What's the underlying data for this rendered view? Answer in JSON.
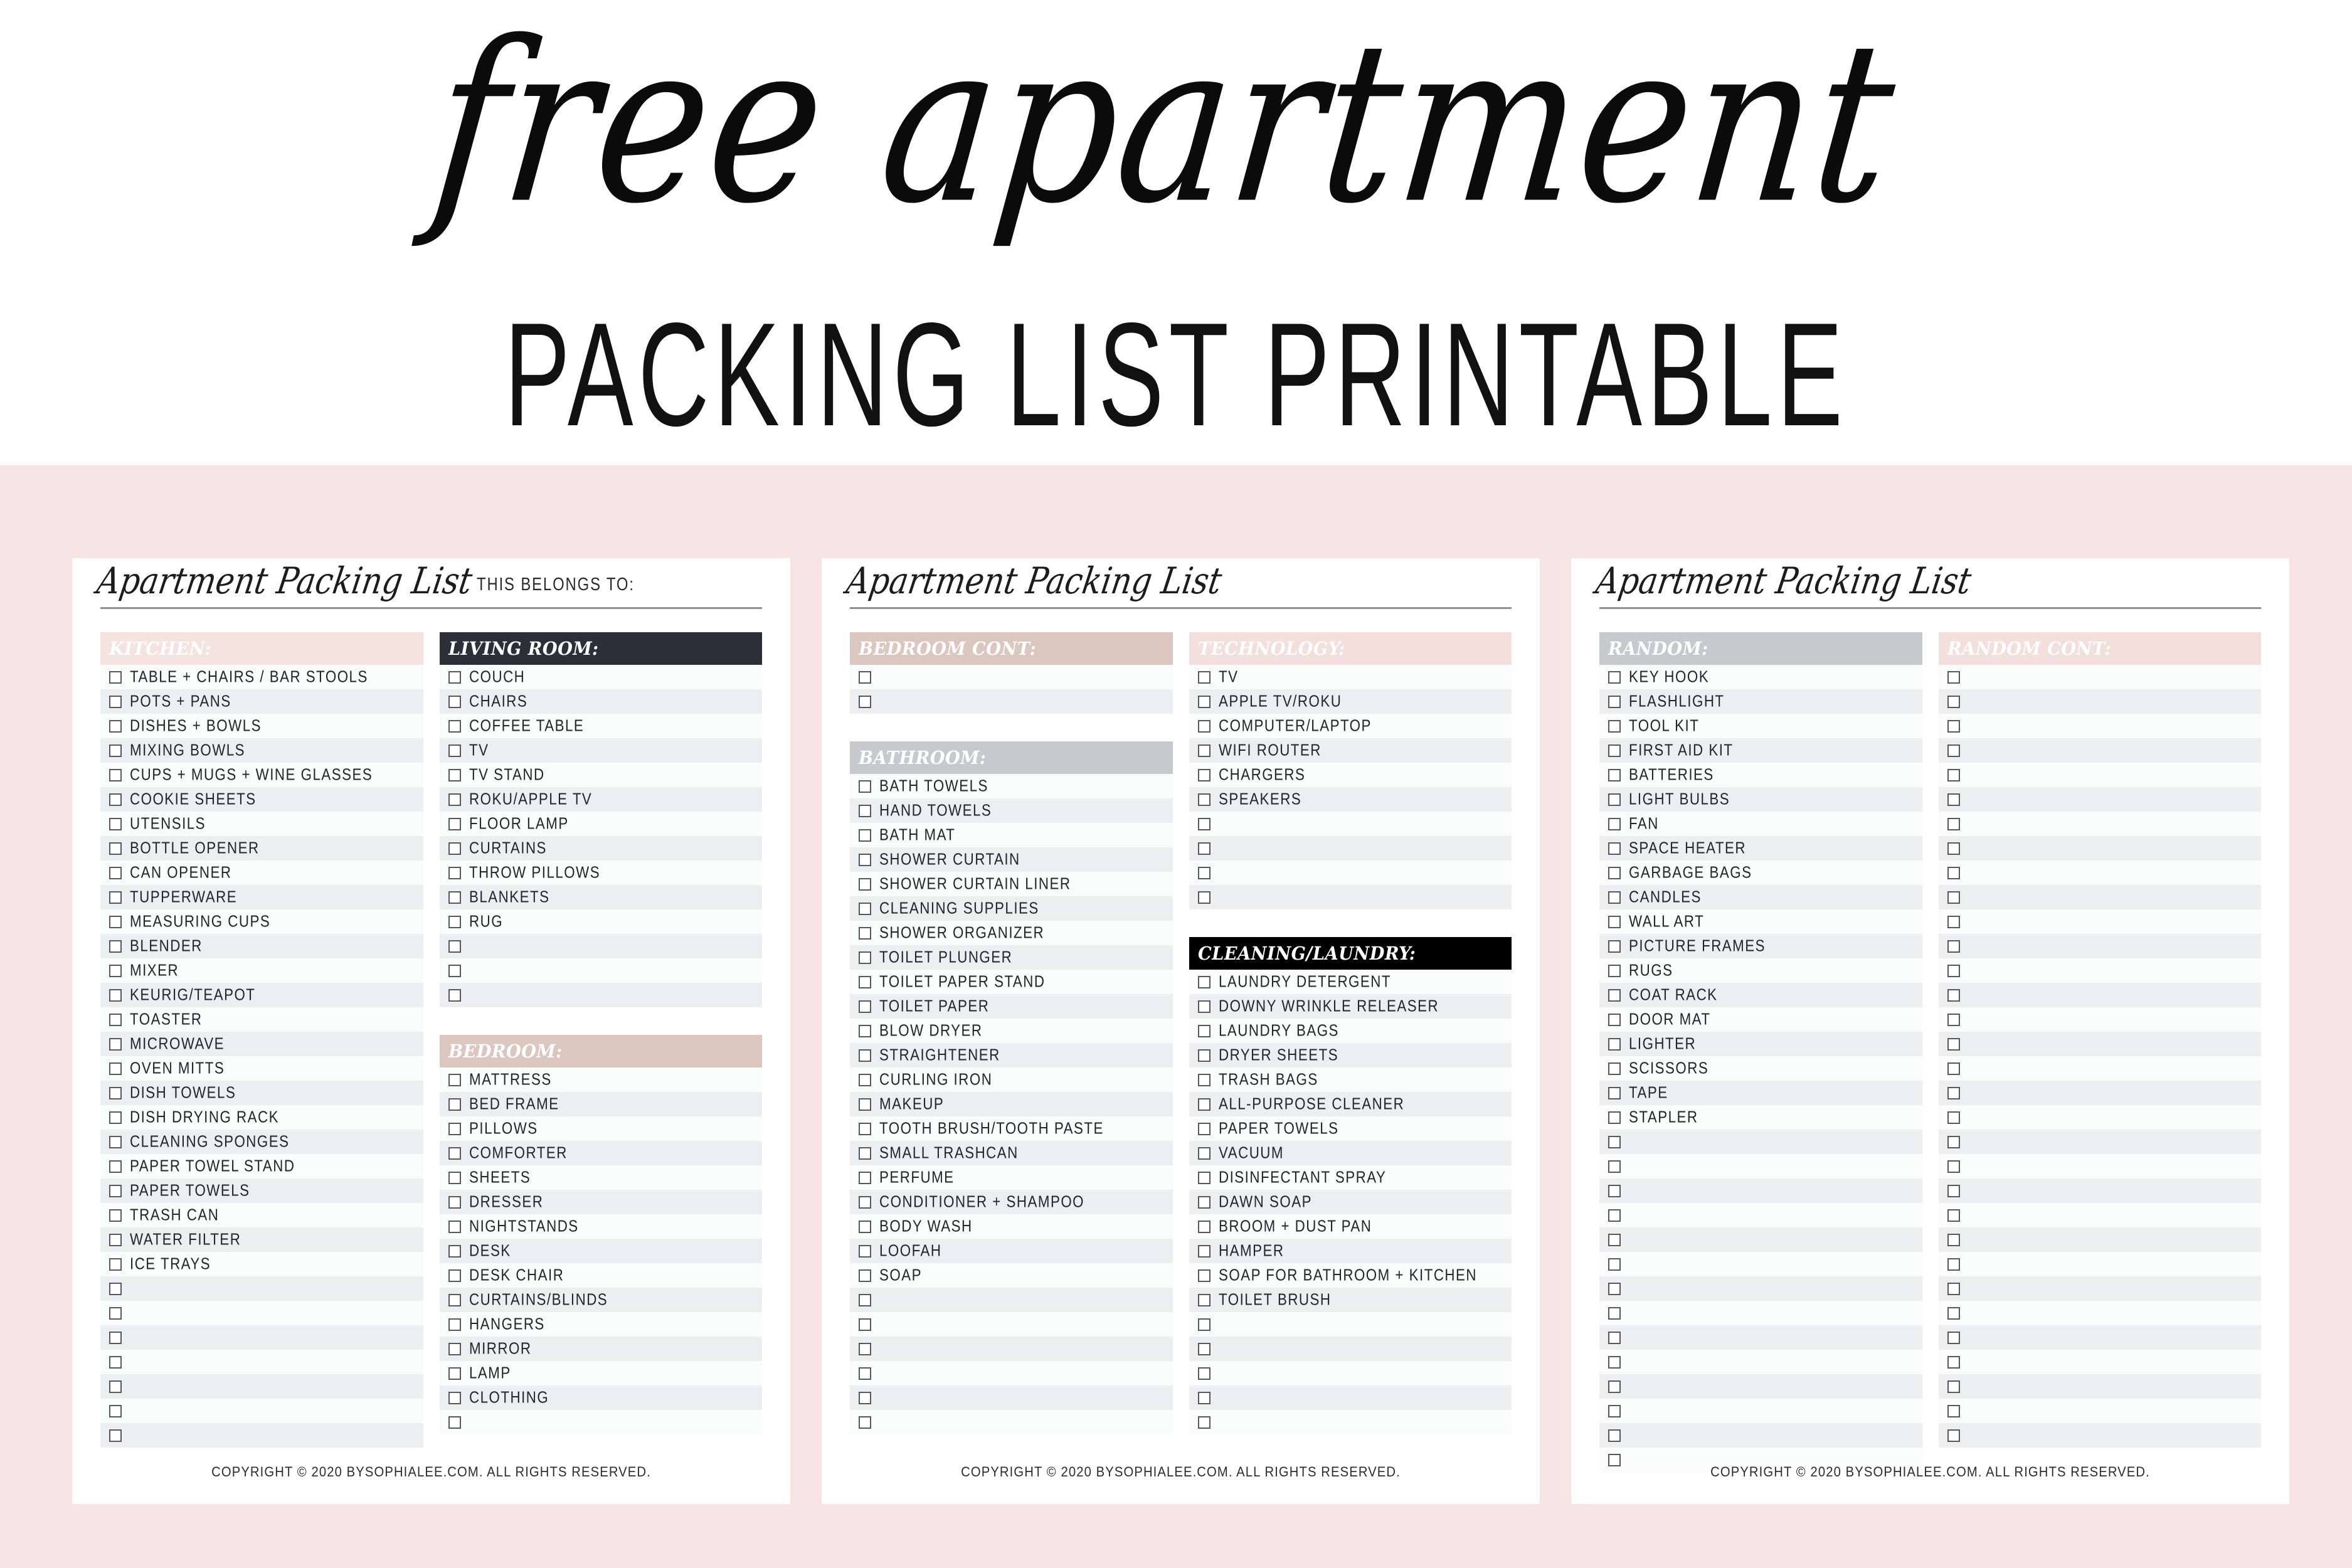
{
  "hero": {
    "script_line": "free apartment",
    "sub_line": "PACKING LIST PRINTABLE"
  },
  "colors": {
    "page_background": "#ffffff",
    "band_background": "#f5e4e1",
    "card_background": "#ffffff",
    "header_pink": "#f5e3e0",
    "header_dark": "#2b2f38",
    "header_tan": "#dcc7c0",
    "header_gray": "#c6cacd",
    "header_black": "#000000",
    "row_alt": "#eceef0",
    "row_plain": "#fafbfb",
    "checkbox_border": "#55595e",
    "rule": "#8d9196",
    "text": "#23252a"
  },
  "cards": [
    {
      "title": "Apartment Packing List",
      "belongs_to_label": "THIS BELONGS TO:",
      "copyright": "COPYRIGHT © 2020 BYSOPHIALEE.COM. ALL RIGHTS RESERVED.",
      "left_sections": [
        {
          "heading": "KITCHEN:",
          "style": "h-pink",
          "items": [
            "TABLE + CHAIRS / BAR STOOLS",
            "POTS + PANS",
            "DISHES + BOWLS",
            "MIXING BOWLS",
            "CUPS + MUGS + WINE GLASSES",
            "COOKIE SHEETS",
            "UTENSILS",
            "BOTTLE OPENER",
            "CAN OPENER",
            "TUPPERWARE",
            "MEASURING CUPS",
            "BLENDER",
            "MIXER",
            "KEURIG/TEAPOT",
            "TOASTER",
            "MICROWAVE",
            "OVEN MITTS",
            "DISH TOWELS",
            "DISH DRYING RACK",
            "CLEANING SPONGES",
            "PAPER TOWEL STAND",
            "PAPER TOWELS",
            "TRASH CAN",
            "WATER FILTER",
            "ICE TRAYS",
            "",
            "",
            "",
            "",
            "",
            "",
            ""
          ]
        }
      ],
      "right_sections": [
        {
          "heading": "LIVING ROOM:",
          "style": "h-dark",
          "items": [
            "COUCH",
            "CHAIRS",
            "COFFEE TABLE",
            "TV",
            "TV STAND",
            "ROKU/APPLE TV",
            "FLOOR LAMP",
            "CURTAINS",
            "THROW PILLOWS",
            "BLANKETS",
            "RUG",
            "",
            "",
            ""
          ]
        },
        {
          "heading": "BEDROOM:",
          "style": "h-tan",
          "items": [
            "MATTRESS",
            "BED FRAME",
            "PILLOWS",
            "COMFORTER",
            "SHEETS",
            "DRESSER",
            "NIGHTSTANDS",
            "DESK",
            "DESK CHAIR",
            "CURTAINS/BLINDS",
            "HANGERS",
            "MIRROR",
            "LAMP",
            "CLOTHING",
            ""
          ]
        }
      ]
    },
    {
      "title": "Apartment Packing List",
      "belongs_to_label": "",
      "copyright": "COPYRIGHT © 2020 BYSOPHIALEE.COM. ALL RIGHTS RESERVED.",
      "left_sections": [
        {
          "heading": "BEDROOM CONT:",
          "style": "h-tan",
          "items": [
            "",
            ""
          ]
        },
        {
          "heading": "BATHROOM:",
          "style": "h-gray",
          "items": [
            "BATH TOWELS",
            "HAND TOWELS",
            "BATH MAT",
            "SHOWER CURTAIN",
            "SHOWER CURTAIN LINER",
            "CLEANING SUPPLIES",
            "SHOWER ORGANIZER",
            "TOILET PLUNGER",
            "TOILET PAPER STAND",
            "TOILET PAPER",
            "BLOW DRYER",
            "STRAIGHTENER",
            "CURLING IRON",
            "MAKEUP",
            "TOOTH BRUSH/TOOTH PASTE",
            "SMALL TRASHCAN",
            "PERFUME",
            "CONDITIONER + SHAMPOO",
            "BODY WASH",
            "LOOFAH",
            "SOAP",
            "",
            "",
            "",
            "",
            "",
            ""
          ]
        }
      ],
      "right_sections": [
        {
          "heading": "TECHNOLOGY:",
          "style": "h-blush",
          "items": [
            "TV",
            "APPLE TV/ROKU",
            "COMPUTER/LAPTOP",
            "WIFI ROUTER",
            "CHARGERS",
            "SPEAKERS",
            "",
            "",
            "",
            ""
          ]
        },
        {
          "heading": "CLEANING/LAUNDRY:",
          "style": "h-black",
          "items": [
            "LAUNDRY DETERGENT",
            "DOWNY WRINKLE RELEASER",
            "LAUNDRY BAGS",
            "DRYER SHEETS",
            "TRASH BAGS",
            "ALL-PURPOSE CLEANER",
            "PAPER TOWELS",
            "VACUUM",
            "DISINFECTANT SPRAY",
            "DAWN SOAP",
            "BROOM + DUST PAN",
            "HAMPER",
            "SOAP FOR BATHROOM + KITCHEN",
            "TOILET BRUSH",
            "",
            "",
            "",
            "",
            ""
          ]
        }
      ]
    },
    {
      "title": "Apartment Packing List",
      "belongs_to_label": "",
      "copyright": "COPYRIGHT © 2020 BYSOPHIALEE.COM. ALL RIGHTS RESERVED.",
      "left_sections": [
        {
          "heading": "RANDOM:",
          "style": "h-gray",
          "items": [
            "KEY HOOK",
            "FLASHLIGHT",
            "TOOL KIT",
            "FIRST AID KIT",
            "BATTERIES",
            "LIGHT BULBS",
            "FAN",
            "SPACE HEATER",
            "GARBAGE BAGS",
            "CANDLES",
            "WALL ART",
            "PICTURE FRAMES",
            "RUGS",
            "COAT RACK",
            "DOOR MAT",
            "LIGHTER",
            "SCISSORS",
            "TAPE",
            "STAPLER",
            "",
            "",
            "",
            "",
            "",
            "",
            "",
            "",
            "",
            "",
            "",
            "",
            "",
            ""
          ]
        }
      ],
      "right_sections": [
        {
          "heading": "RANDOM CONT:",
          "style": "h-blush",
          "items": [
            "",
            "",
            "",
            "",
            "",
            "",
            "",
            "",
            "",
            "",
            "",
            "",
            "",
            "",
            "",
            "",
            "",
            "",
            "",
            "",
            "",
            "",
            "",
            "",
            "",
            "",
            "",
            "",
            "",
            "",
            "",
            ""
          ]
        }
      ]
    }
  ]
}
